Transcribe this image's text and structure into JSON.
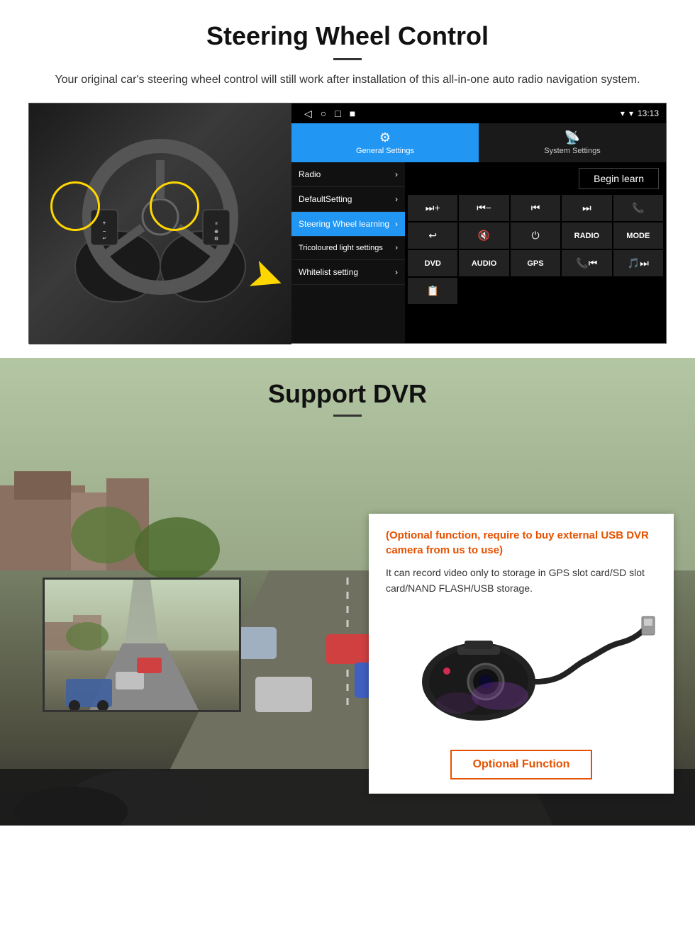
{
  "steering_section": {
    "title": "Steering Wheel Control",
    "description": "Your original car's steering wheel control will still work after installation of this all-in-one auto radio navigation system.",
    "android_topbar": {
      "time": "13:13",
      "nav_icons": [
        "◁",
        "○",
        "□",
        "■"
      ]
    },
    "settings_tabs": [
      {
        "id": "general",
        "icon": "⚙",
        "label": "General Settings",
        "active": true
      },
      {
        "id": "system",
        "icon": "📶",
        "label": "System Settings",
        "active": false
      }
    ],
    "menu_items": [
      {
        "label": "Radio",
        "active": false
      },
      {
        "label": "DefaultSetting",
        "active": false
      },
      {
        "label": "Steering Wheel learning",
        "active": true
      },
      {
        "label": "Tricoloured light settings",
        "active": false
      },
      {
        "label": "Whitelist setting",
        "active": false
      }
    ],
    "begin_learn_label": "Begin learn",
    "control_buttons": [
      "⏭+",
      "⏮−",
      "⏮⏮",
      "⏭⏭",
      "📞",
      "↩",
      "🔇×",
      "⏻",
      "RADIO",
      "MODE",
      "DVD",
      "AUDIO",
      "GPS",
      "📞⏮",
      "🎵⏭"
    ],
    "extra_btn": "📋"
  },
  "dvr_section": {
    "title": "Support DVR",
    "optional_note": "(Optional function, require to buy external USB DVR camera from us to use)",
    "description": "It can record video only to storage in GPS slot card/SD slot card/NAND FLASH/USB storage.",
    "optional_function_label": "Optional Function"
  }
}
